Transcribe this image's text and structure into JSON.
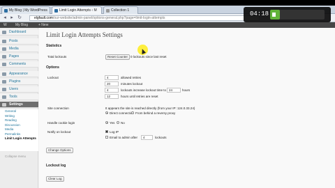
{
  "browser": {
    "tabs": [
      {
        "label": "My Blog | My WordPress"
      },
      {
        "label": "Limit Login Attempts ‹ M"
      },
      {
        "label": "Collection 1"
      }
    ],
    "url_host": "elgfault.com",
    "url_path": "/our-website/admin-panel/options-general.php?page=limit-login-attempts"
  },
  "adminbar": {
    "site": "My Blog",
    "new": "+ New"
  },
  "sidebar": {
    "items": [
      {
        "label": "Dashboard"
      },
      {
        "label": "Posts"
      },
      {
        "label": "Media"
      },
      {
        "label": "Pages"
      },
      {
        "label": "Comments"
      },
      {
        "label": "Appearance"
      },
      {
        "label": "Plugins"
      },
      {
        "label": "Users"
      },
      {
        "label": "Tools"
      },
      {
        "label": "Settings"
      }
    ],
    "submenu": [
      "General",
      "Writing",
      "Reading",
      "Discussion",
      "Media",
      "Permalinks",
      "Limit Login Attempts"
    ],
    "collapse": "Collapse menu"
  },
  "page": {
    "title": "Limit Login Attempts Settings",
    "statistics_heading": "Statistics",
    "total_lockouts_label": "Total lockouts",
    "reset_button": "Reset Counter",
    "reset_note": "0 lockouts since last reset",
    "options_heading": "Options",
    "lockout_label": "Lockout",
    "allowed_retries": {
      "value": "4",
      "label": "allowed retries"
    },
    "minutes_lockout": {
      "value": "20",
      "label": "minutes lockout"
    },
    "lockouts_increase": {
      "value": "4",
      "label": "lockouts increase lockout time to",
      "value2": "24",
      "unit": "hours"
    },
    "hours_reset": {
      "value": "12",
      "label": "hours until retries are reset"
    },
    "site_connection_label": "Site connection",
    "site_connection_note": "It appears the site is reached directly (from your IP: 124.0.33.24)",
    "direct_connection": "Direct connection",
    "reverse_proxy": "From behind a reversy proxy",
    "cookie_label": "Handle cookie login",
    "cookie_yes": "Yes",
    "cookie_no": "No",
    "notify_label": "Notify on lockout",
    "log_ip": "Log IP",
    "email_admin": "Email to admin after",
    "email_value": "4",
    "email_suffix": "lockouts",
    "change_button": "Change Options",
    "lockout_log_heading": "Lockout log",
    "clear_log_button": "Clear Log"
  },
  "video": {
    "time": "04:18",
    "progress": 0.18
  }
}
